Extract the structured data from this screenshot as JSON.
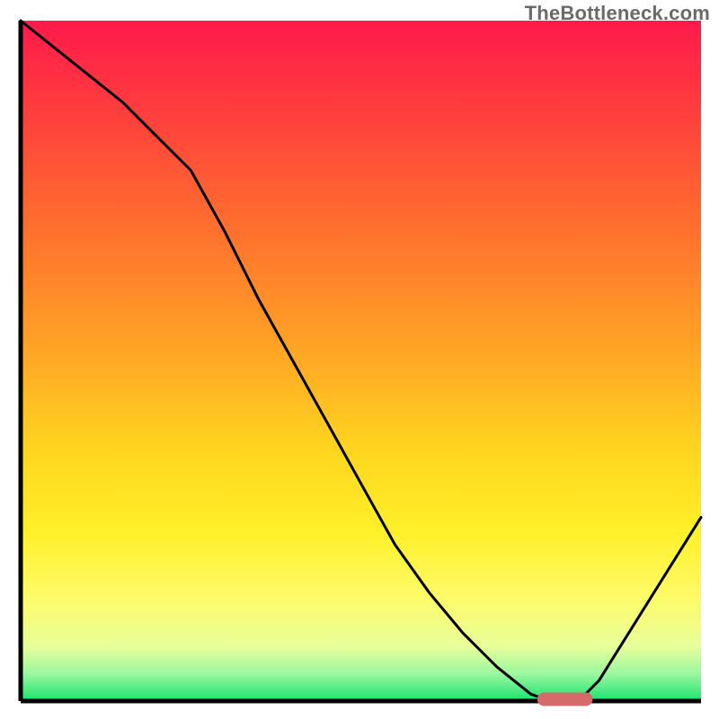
{
  "watermark": "TheBottleneck.com",
  "colors": {
    "curve": "#000000",
    "marker": "#d66a6a",
    "gradient_top": "#ff1a4b",
    "gradient_bottom": "#18e36e"
  },
  "chart_data": {
    "type": "line",
    "title": "",
    "xlabel": "",
    "ylabel": "",
    "xlim": [
      0,
      100
    ],
    "ylim": [
      0,
      100
    ],
    "x": [
      0,
      5,
      10,
      15,
      20,
      25,
      30,
      35,
      40,
      45,
      50,
      55,
      60,
      65,
      70,
      75,
      78,
      82,
      85,
      90,
      95,
      100
    ],
    "values": [
      100,
      96,
      92,
      88,
      83,
      78,
      69,
      59,
      50,
      41,
      32,
      23,
      16,
      10,
      5,
      1,
      0,
      0,
      3,
      11,
      19,
      27
    ],
    "optimal_range_x": [
      76,
      84
    ],
    "marker_y": 0
  }
}
